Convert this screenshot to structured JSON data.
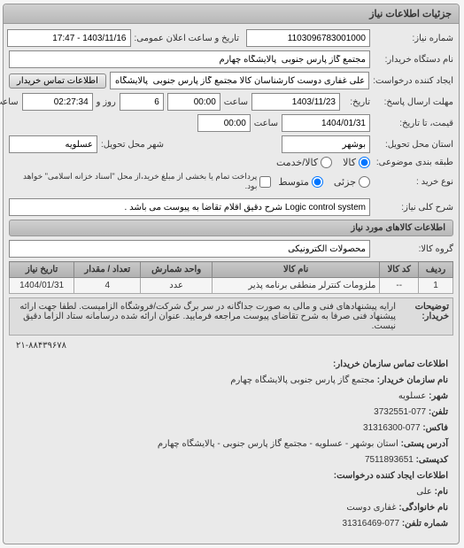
{
  "panel_title": "جزئیات اطلاعات نیاز",
  "form": {
    "request_number_label": "شماره نیاز:",
    "request_number": "1103096783001000",
    "announcement_label": "تاریخ و ساعت اعلان عمومی:",
    "announcement_datetime": "1403/11/16 - 17:47",
    "buyer_org_label": "نام دستگاه خریدار:",
    "buyer_org": "مجتمع گاز پارس جنوبی  پالایشگاه چهارم",
    "requester_label": "ایجاد کننده درخواست:",
    "requester": "علی غفاری دوست کارشناسان کالا مجتمع گاز پارس جنوبی  پالایشگاه چهارم",
    "contact_btn": "اطلاعات تماس خریدار",
    "deadline_label": "مهلت ارسال پاسخ:",
    "deadline_date": "1403/11/23",
    "deadline_time_label": "ساعت",
    "deadline_time": "00:00",
    "days_label": "روز و",
    "days_value": "6",
    "remaining_time": "02:27:34",
    "remaining_label": "ساعت باقی مانده",
    "price_label": "قیمت، تا تاریخ:",
    "price_date": "1404/01/31",
    "price_time": "00:00",
    "province_label": "استان محل تحویل:",
    "province": "بوشهر",
    "city_label": "شهر محل تحویل:",
    "city": "عسلویه",
    "budget_label": "طبقه بندی موضوعی:",
    "budget_goods": "کالا",
    "budget_service": "کالا/خدمت",
    "type_label": "نوع خرید :",
    "type_small": "جزئی",
    "type_medium": "متوسط",
    "payment_note": "پرداخت تمام یا بخشی از مبلغ خرید،از محل \"اسناد خزانه اسلامی\" خواهد بود.",
    "desc_title_label": "شرح کلی نیاز:",
    "desc_title": "Logic control system شرح دقیق اقلام تقاضا به پیوست می باشد ."
  },
  "goods_section_title": "اطلاعات کالاهای مورد نیاز",
  "goods_group_label": "گروه کالا:",
  "goods_group": "محصولات الکترونیکی",
  "table": {
    "headers": {
      "row": "ردیف",
      "code": "کد کالا",
      "name": "نام کالا",
      "unit": "واحد شمارش",
      "qty": "تعداد / مقدار",
      "date": "تاریخ نیاز"
    },
    "rows": [
      {
        "idx": "1",
        "code": "--",
        "name": "ملزومات کنترلر منطقی برنامه پذیر",
        "unit": "عدد",
        "qty": "4",
        "date": "1404/01/31"
      }
    ]
  },
  "buyer_notes": {
    "label": "توضیحات خریدار:",
    "text": "ارایه پیشنهادهای فنی و مالی به صورت جداگانه در سر برگ شرکت/فروشگاه الزامیست. لطفا جهت ارائه پیشنهاد فنی صرفا به شرح تقاضای پیوست مراجعه فرمایید. عنوان ارائه شده درسامانه ستاد الزاما دقیق نیست."
  },
  "contact_number": "۲۱-۸۸۴۳۹۶۷۸",
  "contact_section": {
    "title": "اطلاعات تماس سازمان خریدار:",
    "org_label": "نام سازمان خریدار:",
    "org": "مجتمع گاز پارس جنوبی پالایشگاه چهارم",
    "city_label": "شهر:",
    "city": "عسلویه",
    "phone_label": "تلفن:",
    "phone": "077-3732551",
    "fax_label": "فاکس:",
    "fax": "077-31316300",
    "postal_label": "آدرس پستی:",
    "postal": "استان بوشهر - عسلویه - مجتمع گاز پارس جنوبی - پالایشگاه چهارم",
    "postcode_label": "کدپستی:",
    "postcode": "7511893651",
    "requester_title": "اطلاعات ایجاد کننده درخواست:",
    "name_label": "نام:",
    "name": "علی",
    "lastname_label": "نام خانوادگی:",
    "lastname": "غفاری دوست",
    "tel_label": "شماره تلفن:",
    "tel": "077-31316469"
  }
}
